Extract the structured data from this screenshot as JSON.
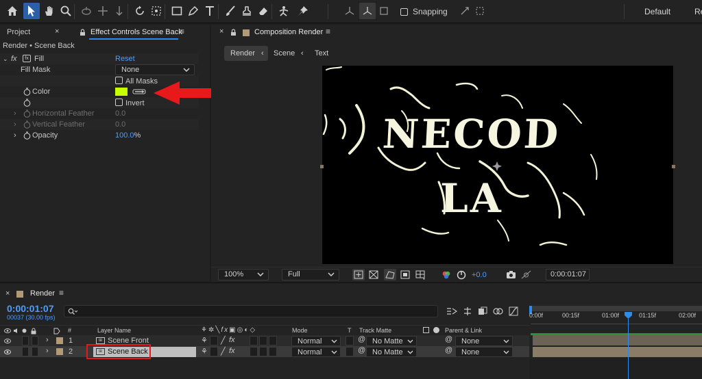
{
  "toolbar": {
    "snapping_label": "Snapping",
    "workspace_default": "Default",
    "workspace_next": "Re"
  },
  "left_panel": {
    "tab_project": "Project",
    "tab_effect_controls": "Effect Controls Scene Back",
    "breadcrumb": "Render • Scene Back",
    "effect_name": "Fill",
    "reset_label": "Reset",
    "fill_mask_label": "Fill Mask",
    "fill_mask_value": "None",
    "all_masks_label": "All Masks",
    "color_label": "Color",
    "color_swatch": "#c8ff00",
    "invert_label": "Invert",
    "horizontal_feather_label": "Horizontal Feather",
    "horizontal_feather_value": "0.0",
    "vertical_feather_label": "Vertical Feather",
    "vertical_feather_value": "0.0",
    "opacity_label": "Opacity",
    "opacity_value": "100.0",
    "opacity_unit": "%"
  },
  "composition": {
    "tab_label": "Composition Render",
    "breadcrumbs": [
      "Render",
      "Scene",
      "Text"
    ],
    "zoom": "100%",
    "resolution": "Full",
    "exposure": "+0.0",
    "timecode": "0:00:01:07",
    "canvas_text_line1": "NECOD",
    "canvas_text_line2": "LA"
  },
  "timeline": {
    "tab_label": "Render",
    "current_time": "0:00:01:07",
    "frame_info": "00037 (30.00 fps)",
    "search_placeholder": "",
    "col_hash": "#",
    "col_layer_name": "Layer Name",
    "col_mode": "Mode",
    "col_t": "T",
    "col_track_matte": "Track Matte",
    "col_parent": "Parent & Link",
    "ruler_ticks": [
      "0:00f",
      "00:15f",
      "01:00f",
      "01:15f",
      "02:00f"
    ],
    "layers": [
      {
        "num": "1",
        "name": "Scene Front",
        "mode": "Normal",
        "matte": "No Matte",
        "parent": "None"
      },
      {
        "num": "2",
        "name": "Scene Back",
        "mode": "Normal",
        "matte": "No Matte",
        "parent": "None"
      }
    ]
  },
  "colors": {
    "accent_blue": "#2d8ceb",
    "annotation_red": "#e8191a",
    "fill_color": "#c8ff00"
  }
}
